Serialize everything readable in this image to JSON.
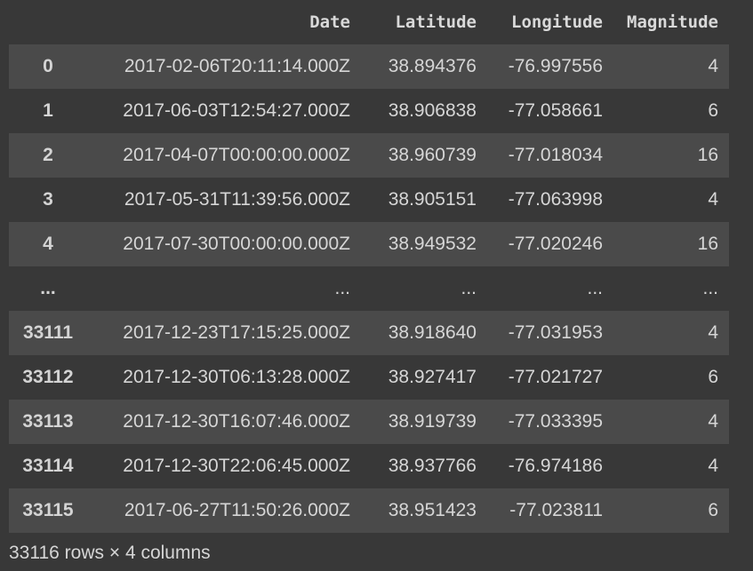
{
  "table": {
    "columns": [
      "Date",
      "Latitude",
      "Longitude",
      "Magnitude"
    ],
    "rows": [
      {
        "index": "0",
        "date": "2017-02-06T20:11:14.000Z",
        "latitude": "38.894376",
        "longitude": "-76.997556",
        "magnitude": "4"
      },
      {
        "index": "1",
        "date": "2017-06-03T12:54:27.000Z",
        "latitude": "38.906838",
        "longitude": "-77.058661",
        "magnitude": "6"
      },
      {
        "index": "2",
        "date": "2017-04-07T00:00:00.000Z",
        "latitude": "38.960739",
        "longitude": "-77.018034",
        "magnitude": "16"
      },
      {
        "index": "3",
        "date": "2017-05-31T11:39:56.000Z",
        "latitude": "38.905151",
        "longitude": "-77.063998",
        "magnitude": "4"
      },
      {
        "index": "4",
        "date": "2017-07-30T00:00:00.000Z",
        "latitude": "38.949532",
        "longitude": "-77.020246",
        "magnitude": "16"
      },
      {
        "index": "...",
        "date": "...",
        "latitude": "...",
        "longitude": "...",
        "magnitude": "..."
      },
      {
        "index": "33111",
        "date": "2017-12-23T17:15:25.000Z",
        "latitude": "38.918640",
        "longitude": "-77.031953",
        "magnitude": "4"
      },
      {
        "index": "33112",
        "date": "2017-12-30T06:13:28.000Z",
        "latitude": "38.927417",
        "longitude": "-77.021727",
        "magnitude": "6"
      },
      {
        "index": "33113",
        "date": "2017-12-30T16:07:46.000Z",
        "latitude": "38.919739",
        "longitude": "-77.033395",
        "magnitude": "4"
      },
      {
        "index": "33114",
        "date": "2017-12-30T22:06:45.000Z",
        "latitude": "38.937766",
        "longitude": "-76.974186",
        "magnitude": "4"
      },
      {
        "index": "33115",
        "date": "2017-06-27T11:50:26.000Z",
        "latitude": "38.951423",
        "longitude": "-77.023811",
        "magnitude": "6"
      }
    ]
  },
  "footer": {
    "shape_text": "33116 rows × 4 columns"
  },
  "colors": {
    "background": "#383838",
    "stripe": "#4a4a4a",
    "text": "#d6d6d6"
  }
}
